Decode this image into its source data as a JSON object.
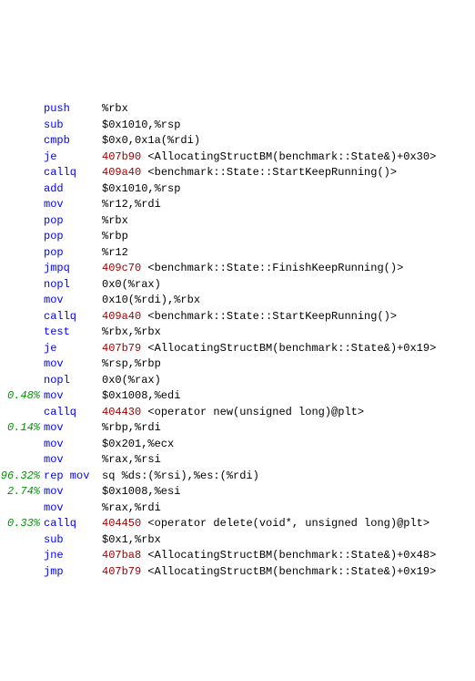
{
  "lines": [
    {
      "pct": "",
      "mne": "push",
      "ops": "%rbx"
    },
    {
      "pct": "",
      "mne": "sub",
      "ops": "$0x1010,%rsp"
    },
    {
      "pct": "",
      "mne": "cmpb",
      "ops": "$0x0,0x1a(%rdi)"
    },
    {
      "pct": "",
      "mne": "je",
      "addr": "407b90 ",
      "tail": "<AllocatingStructBM(benchmark::State&)+0x30>"
    },
    {
      "pct": "",
      "mne": "callq",
      "addr": "409a40 ",
      "tail": "<benchmark::State::StartKeepRunning()>"
    },
    {
      "pct": "",
      "mne": "add",
      "ops": "$0x1010,%rsp"
    },
    {
      "pct": "",
      "mne": "mov",
      "ops": "%r12,%rdi"
    },
    {
      "pct": "",
      "mne": "pop",
      "ops": "%rbx"
    },
    {
      "pct": "",
      "mne": "pop",
      "ops": "%rbp"
    },
    {
      "pct": "",
      "mne": "pop",
      "ops": "%r12"
    },
    {
      "pct": "",
      "mne": "jmpq",
      "addr": "409c70 ",
      "tail": "<benchmark::State::FinishKeepRunning()>"
    },
    {
      "pct": "",
      "mne": "nopl",
      "ops": "0x0(%rax)"
    },
    {
      "pct": "",
      "mne": "mov",
      "ops": "0x10(%rdi),%rbx"
    },
    {
      "pct": "",
      "mne": "callq",
      "addr": "409a40 ",
      "tail": "<benchmark::State::StartKeepRunning()>"
    },
    {
      "pct": "",
      "mne": "test",
      "ops": "%rbx,%rbx"
    },
    {
      "pct": "",
      "mne": "je",
      "addr": "407b79 ",
      "tail": "<AllocatingStructBM(benchmark::State&)+0x19>"
    },
    {
      "pct": "",
      "mne": "mov",
      "ops": "%rsp,%rbp"
    },
    {
      "pct": "",
      "mne": "nopl",
      "ops": "0x0(%rax)"
    },
    {
      "pct": "0.48%",
      "mne": "mov",
      "ops": "$0x1008,%edi"
    },
    {
      "pct": "",
      "mne": "callq",
      "addr": "404430 ",
      "tail": "<operator new(unsigned long)@plt>"
    },
    {
      "pct": "0.14%",
      "mne": "mov",
      "ops": "%rbp,%rdi"
    },
    {
      "pct": "",
      "mne": "mov",
      "ops": "$0x201,%ecx"
    },
    {
      "pct": "",
      "mne": "mov",
      "ops": "%rax,%rsi"
    },
    {
      "pct": "96.32%",
      "mne": "rep mov",
      "ops": "sq %ds:(%rsi),%es:(%rdi)"
    },
    {
      "pct": "2.74%",
      "mne": "mov",
      "ops": "$0x1008,%esi"
    },
    {
      "pct": "",
      "mne": "mov",
      "ops": "%rax,%rdi"
    },
    {
      "pct": "0.33%",
      "mne": "callq",
      "addr": "404450 ",
      "tail": "<operator delete(void*, unsigned long)@plt>"
    },
    {
      "pct": "",
      "mne": "sub",
      "ops": "$0x1,%rbx"
    },
    {
      "pct": "",
      "mne": "jne",
      "addr": "407ba8 ",
      "tail": "<AllocatingStructBM(benchmark::State&)+0x48>"
    },
    {
      "pct": "",
      "mne": "jmp",
      "addr": "407b79 ",
      "tail": "<AllocatingStructBM(benchmark::State&)+0x19>"
    }
  ]
}
